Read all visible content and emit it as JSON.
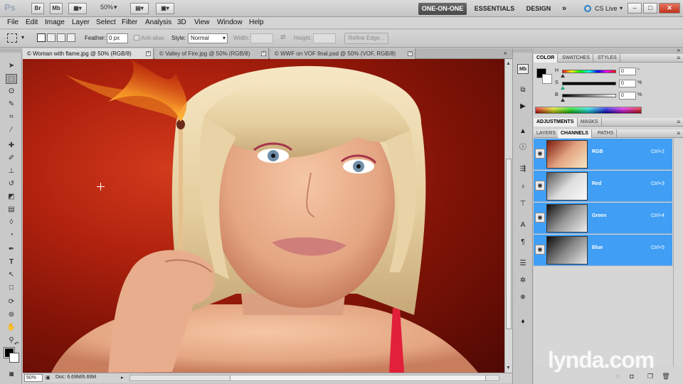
{
  "appbar": {
    "logo": "Ps",
    "buttons": [
      "Br",
      "Mb"
    ],
    "zoom": "50%",
    "workspaces": [
      {
        "label": "ONE-ON-ONE",
        "active": true
      },
      {
        "label": "ESSENTIALS",
        "active": false
      },
      {
        "label": "DESIGN",
        "active": false
      }
    ],
    "more": "»",
    "cslive": "CS Live",
    "window_buttons": [
      "–",
      "□",
      "✕"
    ]
  },
  "menubar": [
    "File",
    "Edit",
    "Image",
    "Layer",
    "Select",
    "Filter",
    "Analysis",
    "3D",
    "View",
    "Window",
    "Help"
  ],
  "options": {
    "feather_label": "Feather:",
    "feather_value": "0 px",
    "antialias_label": "Anti-alias",
    "style_label": "Style:",
    "style_value": "Normal",
    "width_label": "Width:",
    "height_label": "Height:",
    "refine_label": "Refine Edge..."
  },
  "tabs": [
    {
      "label": "© Woman with flame.jpg @ 50% (RGB/8)",
      "active": true
    },
    {
      "label": "© Valley of Fire.jpg @ 50% (RGB/8)",
      "active": false
    },
    {
      "label": "© WWF on VOF final.psd @ 50% (VOF, RGB/8)",
      "active": false
    }
  ],
  "status": {
    "zoom": "50%",
    "doc_info": "Doc: 6.69M/6.69M"
  },
  "color_panel": {
    "tabs": [
      "COLOR",
      "SWATCHES",
      "STYLES"
    ],
    "sliders": [
      {
        "label": "H",
        "value": "0",
        "unit": "°"
      },
      {
        "label": "S",
        "value": "0",
        "unit": "%"
      },
      {
        "label": "B",
        "value": "0",
        "unit": "%"
      }
    ]
  },
  "adjustments_panel": {
    "tabs": [
      "ADJUSTMENTS",
      "MASKS"
    ]
  },
  "channels_panel": {
    "tabs": [
      "LAYERS",
      "CHANNELS",
      "PATHS"
    ],
    "channels": [
      {
        "name": "RGB",
        "shortcut": "Ctrl+2"
      },
      {
        "name": "Red",
        "shortcut": "Ctrl+3"
      },
      {
        "name": "Green",
        "shortcut": "Ctrl+4"
      },
      {
        "name": "Blue",
        "shortcut": "Ctrl+5"
      }
    ]
  },
  "watermark": "lynda.com",
  "colors": {
    "selection_blue": "#409ff5",
    "canvas_red": "#b0220e",
    "workspace_active": "#4a4a4a"
  }
}
